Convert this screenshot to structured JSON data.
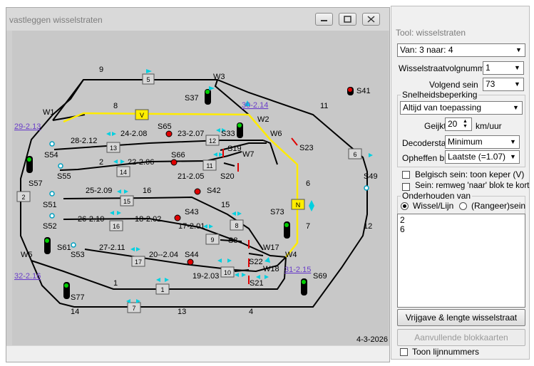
{
  "window": {
    "title": "vastleggen wisselstraten",
    "date": "4-3-2026"
  },
  "map": {
    "links": [
      "29-2.13",
      "30-2.14",
      "31-2.15",
      "32-2.16"
    ],
    "track_numbers": [
      "9",
      "W3",
      "8",
      "11",
      "W1",
      "W2",
      "W6",
      "6",
      "S41",
      "S37",
      "S65",
      "S33",
      "S23",
      "24-2.08",
      "23-2.07",
      "28-2.12",
      "S54",
      "S66",
      "S19",
      "W7",
      "2",
      "22-2.06",
      "21-2.05",
      "S20",
      "S55",
      "S57",
      "25-2.09",
      "16",
      "S42",
      "S49",
      "S51",
      "15",
      "26-2.10",
      "18-2.02",
      "S43",
      "S73",
      "S52",
      "17-2.01",
      "7",
      "12",
      "S8",
      "27-2.11",
      "20--2.04",
      "S61",
      "S53",
      "S44",
      "W17",
      "W4",
      "W18",
      "S22",
      "W5",
      "19-2.03",
      "S69",
      "S21",
      "1",
      "S77",
      "14",
      "13",
      "4"
    ],
    "blocks": [
      "5",
      "V",
      "13",
      "12",
      "14",
      "11",
      "6",
      "N",
      "15",
      "8",
      "16",
      "9",
      "17",
      "10",
      "1",
      "7",
      "2"
    ]
  },
  "tool": {
    "title": "Tool: wisselstraten",
    "route": "Van: 3 naar: 4",
    "volgnummer_label": "Wisselstraatvolgnummer",
    "volgnummer_value": "1",
    "volgend_sein_label": "Volgend sein",
    "volgend_sein_value": "73",
    "snelheid_group": "Snelheidsbeperking",
    "snelheid_value": "Altijd van toepassing",
    "gewijkt_label": "Geijkt",
    "gewijkt_value": "20",
    "gewijkt_unit": "km/uur",
    "decoderstap_label": "Decoderstap",
    "decoderstap_value": "Minimum",
    "opheffen_label": "Opheffen bij",
    "opheffen_value": "Laatste (=1.07)",
    "belgisch_label": "Belgisch sein: toon keper (V)",
    "sein_label": "Sein: remweg 'naar' blok te kort",
    "onderhouden_group": "Onderhouden van",
    "radio_wissel": "Wissel/Lijn",
    "radio_sein": "(Rangeer)sein",
    "list_items": [
      "2",
      "6"
    ],
    "vrijgave_button": "Vrijgave & lengte wisselstraat",
    "aanvullende_button": "Aanvullende blokkaarten",
    "toon_label": "Toon lijnnummers"
  }
}
